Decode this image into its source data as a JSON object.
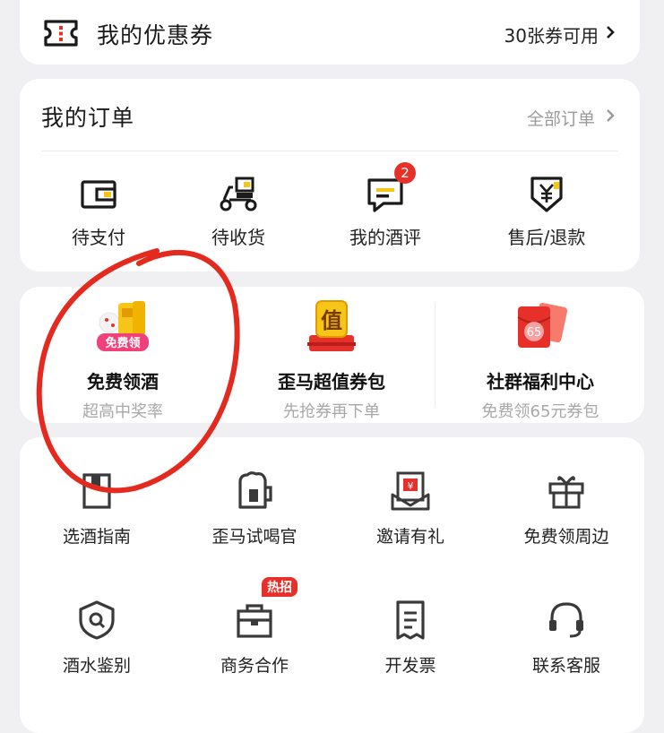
{
  "coupon": {
    "title": "我的优惠券",
    "count_text": "30张券可用",
    "icon": "ticket-icon"
  },
  "orders": {
    "title": "我的订单",
    "all_label": "全部订单",
    "items": [
      {
        "label": "待支付",
        "icon": "wallet-icon"
      },
      {
        "label": "待收货",
        "icon": "delivery-scooter-icon"
      },
      {
        "label": "我的酒评",
        "icon": "comment-icon",
        "badge": "2"
      },
      {
        "label": "售后/退款",
        "icon": "yuan-shield-icon"
      }
    ]
  },
  "promo": {
    "items": [
      {
        "title": "免费领酒",
        "subtitle": "超高中奖率",
        "tag": "免费领",
        "icon": "free-wine-icon"
      },
      {
        "title": "歪马超值券包",
        "subtitle": "先抢券再下单",
        "tag": "值",
        "icon": "value-coupon-icon"
      },
      {
        "title": "社群福利中心",
        "subtitle": "免费领65元券包",
        "tag": "65",
        "icon": "red-envelope-icon"
      }
    ]
  },
  "tools": {
    "items": [
      {
        "label": "选酒指南",
        "icon": "guide-book-icon"
      },
      {
        "label": "歪马试喝官",
        "icon": "beer-mug-icon"
      },
      {
        "label": "邀请有礼",
        "icon": "invite-gift-icon"
      },
      {
        "label": "免费领周边",
        "icon": "gift-box-icon"
      },
      {
        "label": "酒水鉴别",
        "icon": "search-shield-icon"
      },
      {
        "label": "商务合作",
        "icon": "briefcase-icon",
        "tag": "热招"
      },
      {
        "label": "开发票",
        "icon": "receipt-icon"
      },
      {
        "label": "联系客服",
        "icon": "headset-icon"
      }
    ]
  },
  "colors": {
    "accent_red": "#e8302b",
    "gold": "#f5c518",
    "card_bg": "#ffffff",
    "page_bg": "#f0f0f2",
    "muted_text": "#a8a8a8"
  }
}
